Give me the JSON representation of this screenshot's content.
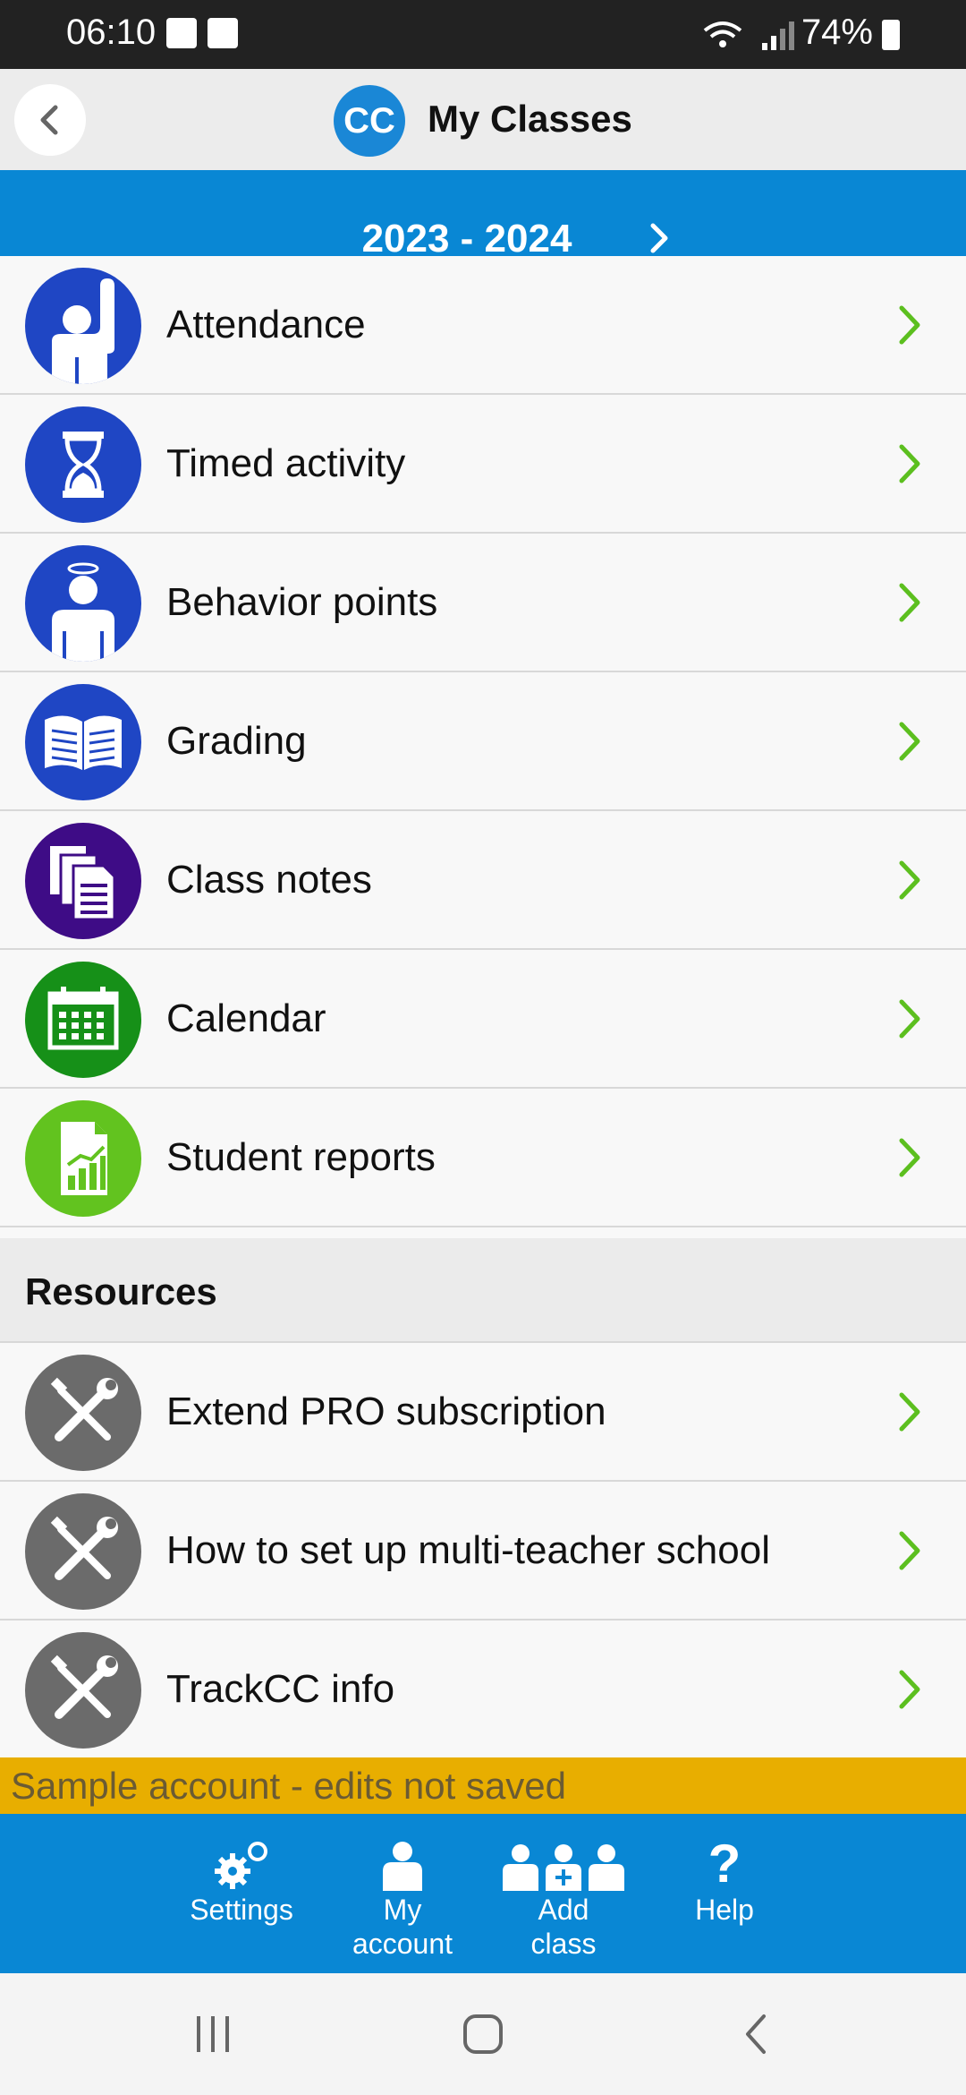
{
  "status": {
    "time": "06:10",
    "battery": "74%"
  },
  "header": {
    "logo": "CC",
    "title": "My Classes"
  },
  "year": {
    "label": "2023 - 2024"
  },
  "menu": [
    {
      "label": "Attendance",
      "icon": "student-hand-icon",
      "color": "#1f46c4"
    },
    {
      "label": "Timed activity",
      "icon": "hourglass-icon",
      "color": "#1f46c4"
    },
    {
      "label": "Behavior points",
      "icon": "halo-student-icon",
      "color": "#1f46c4"
    },
    {
      "label": "Grading",
      "icon": "open-book-icon",
      "color": "#1f46c4"
    },
    {
      "label": "Class notes",
      "icon": "notes-icon",
      "color": "#3e0c86"
    },
    {
      "label": "Calendar",
      "icon": "calendar-icon",
      "color": "#169018"
    },
    {
      "label": "Student reports",
      "icon": "report-chart-icon",
      "color": "#62c31f"
    }
  ],
  "resources": {
    "heading": "Resources",
    "items": [
      {
        "label": "Extend PRO subscription",
        "icon": "tools-icon",
        "color": "#6b6b6b"
      },
      {
        "label": "How to set up multi-teacher school",
        "icon": "tools-icon",
        "color": "#6b6b6b"
      },
      {
        "label": "TrackCC info",
        "icon": "tools-icon",
        "color": "#6b6b6b"
      }
    ]
  },
  "notice": "Sample account - edits not saved",
  "tabbar": {
    "settings": "Settings",
    "my_account_1": "My",
    "my_account_2": "account",
    "add_class_1": "Add",
    "add_class_2": "class",
    "help": "Help"
  },
  "colors": {
    "accent": "#0987d4",
    "chevron": "#5cbf1f",
    "notice": "#e8ae00"
  }
}
